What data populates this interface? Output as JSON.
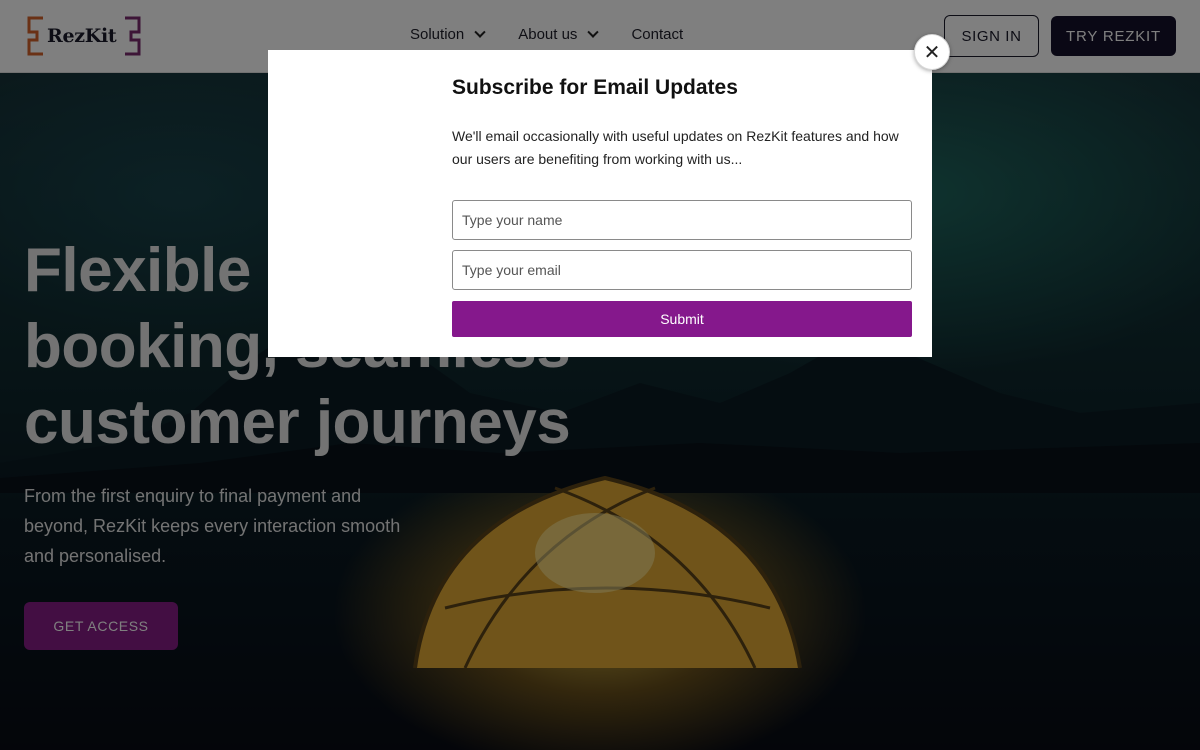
{
  "header": {
    "logo_text": "RezKit",
    "nav": [
      {
        "label": "Solution",
        "has_dropdown": true
      },
      {
        "label": "About us",
        "has_dropdown": true
      },
      {
        "label": "Contact",
        "has_dropdown": false
      }
    ],
    "sign_in_label": "SIGN IN",
    "try_label": "TRY REZKIT"
  },
  "hero": {
    "title_line1": "Flexible tour",
    "title_line2": "booking, seamless",
    "title_line3": "customer journeys",
    "subtitle": "From the first enquiry to final payment and beyond, RezKit keeps every interaction smooth and personalised.",
    "cta_label": "GET ACCESS"
  },
  "modal": {
    "title": "Subscribe for Email Updates",
    "text": "We'll email occasionally with useful updates on RezKit features and how our users are benefiting from working with us...",
    "name_placeholder": "Type your name",
    "email_placeholder": "Type your email",
    "submit_label": "Submit",
    "close_glyph": "✕"
  },
  "colors": {
    "accent_purple": "#85188c",
    "dark_navy": "#15112b",
    "logo_orange": "#d4622a",
    "logo_purple": "#7b2a6e"
  },
  "icons": [
    "chevron-down-icon",
    "close-icon",
    "logo-bracket-icon"
  ]
}
